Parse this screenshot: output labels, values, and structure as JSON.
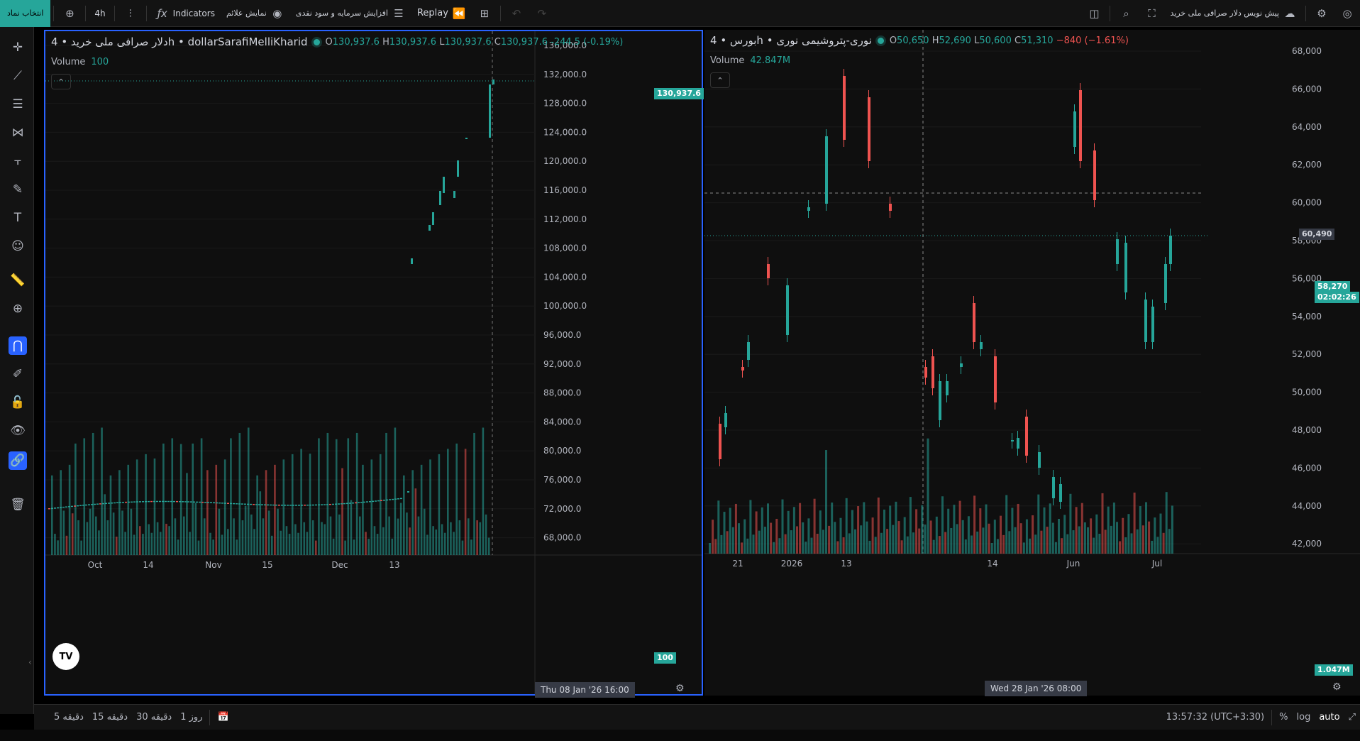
{
  "topbar": {
    "symbol_button": "انتخاب نماد",
    "interval": "4h",
    "indicators": "Indicators",
    "show_symbols": "نمایش علائم",
    "capital_increase": "افزایش سرمایه و سود نقدی",
    "replay": "Replay",
    "default_symbol": "پیش نویس دلار صرافی ملی خرید"
  },
  "left_chart": {
    "title": "دلار صرافی ملی خرید • 4h • dollarSarafiMelliKharid",
    "ohlc": {
      "o": "130,937.6",
      "h": "130,937.6",
      "l": "130,937.6",
      "c": "130,937.6",
      "change": "-244.5 (-0.19%)"
    },
    "volume_label": "Volume",
    "volume_value": "100",
    "price_tag": "130,937.6",
    "volume_tag": "100",
    "crosshair_time": "Thu 08 Jan '26   16:00",
    "y_ticks": [
      "136,000.0",
      "132,000.0",
      "128,000.0",
      "124,000.0",
      "120,000.0",
      "116,000.0",
      "112,000.0",
      "108,000.0",
      "104,000.0",
      "100,000.0",
      "96,000.0",
      "92,000.0",
      "88,000.0",
      "84,000.0",
      "80,000.0",
      "76,000.0",
      "72,000.0",
      "68,000.0"
    ],
    "x_ticks": [
      "Oct",
      "14",
      "Nov",
      "15",
      "Dec",
      "13"
    ]
  },
  "right_chart": {
    "title": "بورس • 4h • نوری-پتروشیمی نوری",
    "ohlc": {
      "o": "50,650",
      "h": "52,690",
      "l": "50,600",
      "c": "51,310",
      "change": "−840 (−1.61%)"
    },
    "volume_label": "Volume",
    "volume_value": "42.847M",
    "crosshair_price": "60,490",
    "price_tag": "58,270",
    "countdown": "02:02:26",
    "volume_tag": "1.047M",
    "crosshair_time": "Wed 28 Jan '26   08:00",
    "y_ticks": [
      "68,000",
      "66,000",
      "64,000",
      "62,000",
      "60,000",
      "58,000",
      "56,000",
      "54,000",
      "52,000",
      "50,000",
      "48,000",
      "46,000",
      "44,000",
      "42,000"
    ],
    "x_ticks": [
      "21",
      "2026",
      "13",
      "14",
      "Jun",
      "Jul"
    ]
  },
  "bottombar": {
    "ranges": [
      "5 دقیقه",
      "15 دقیقه",
      "30 دقیقه",
      "1 روز"
    ],
    "clock": "13:57:32 (UTC+3:30)",
    "percent": "%",
    "log": "log",
    "auto": "auto"
  },
  "colors": {
    "up": "#26a69a",
    "down": "#ef5350",
    "accent": "#2962ff"
  }
}
